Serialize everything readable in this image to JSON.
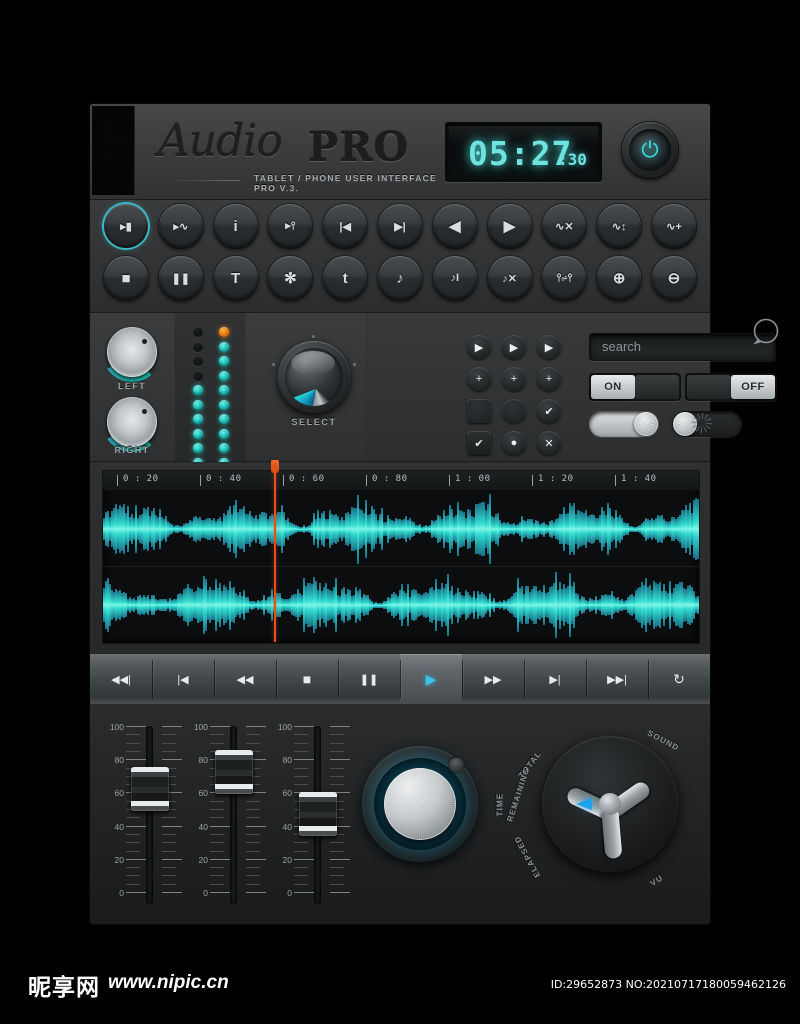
{
  "header": {
    "logo_script": "Audio",
    "logo_bold": "PRO",
    "subtitle": "TABLET / PHONE USER INTERFACE PRO V.3.",
    "clock_main": "05:27",
    "clock_seconds": ":30",
    "power_icon": "power-icon",
    "power_glyph": "⏻",
    "accent_color": "#6fe3e0"
  },
  "button_rows": {
    "row1": [
      {
        "name": "record-marker",
        "glyph": "▸▮",
        "active": true
      },
      {
        "name": "marker-wave",
        "glyph": "▸∿",
        "active": false
      },
      {
        "name": "info",
        "glyph": "i",
        "active": false
      },
      {
        "name": "marker-split",
        "glyph": "▸⫯",
        "active": false
      },
      {
        "name": "skip-start",
        "glyph": "|◀",
        "active": false
      },
      {
        "name": "skip-end",
        "glyph": "▶|",
        "active": false
      },
      {
        "name": "rewind",
        "glyph": "◀",
        "active": false
      },
      {
        "name": "play",
        "glyph": "▶",
        "active": false
      },
      {
        "name": "wave-delete",
        "glyph": "∿✕",
        "active": false
      },
      {
        "name": "wave-adjust",
        "glyph": "∿↕",
        "active": false
      },
      {
        "name": "wave-add",
        "glyph": "∿+",
        "active": false
      }
    ],
    "row2": [
      {
        "name": "stop",
        "glyph": "■"
      },
      {
        "name": "pause",
        "glyph": "❚❚"
      },
      {
        "name": "text",
        "glyph": "T"
      },
      {
        "name": "settings-gear",
        "glyph": "✻"
      },
      {
        "name": "transpose",
        "glyph": "t"
      },
      {
        "name": "note",
        "glyph": "♪"
      },
      {
        "name": "note-edit",
        "glyph": "♪I"
      },
      {
        "name": "note-delete",
        "glyph": "♪✕"
      },
      {
        "name": "waveform-trim",
        "glyph": "⫯⩫⫯"
      },
      {
        "name": "zoom-in",
        "glyph": "⊕"
      },
      {
        "name": "zoom-out",
        "glyph": "⊖"
      }
    ]
  },
  "controls": {
    "knob_left_label": "LEFT",
    "knob_right_label": "RIGHT",
    "select_label": "SELECT",
    "led_left": [
      "off",
      "off",
      "off",
      "off",
      "on",
      "on",
      "on",
      "on",
      "on",
      "on"
    ],
    "led_right": [
      "warn",
      "on",
      "on",
      "on",
      "on",
      "on",
      "on",
      "on",
      "on",
      "on"
    ],
    "mini_buttons": [
      [
        {
          "name": "play-small-1",
          "glyph": "▶"
        },
        {
          "name": "play-small-2",
          "glyph": "▶"
        },
        {
          "name": "play-small-3",
          "glyph": "▶"
        }
      ],
      [
        {
          "name": "add-1",
          "glyph": "+"
        },
        {
          "name": "add-2",
          "glyph": "+"
        },
        {
          "name": "add-3",
          "glyph": "+"
        }
      ],
      [
        {
          "name": "checkbox-empty",
          "glyph": ""
        },
        {
          "name": "radio-empty",
          "glyph": ""
        },
        {
          "name": "check-circle",
          "glyph": "✔"
        }
      ],
      [
        {
          "name": "checkbox-checked",
          "glyph": "✔"
        },
        {
          "name": "radio-selected",
          "glyph": "●"
        },
        {
          "name": "close-circle",
          "glyph": "✕"
        }
      ]
    ],
    "search_placeholder": "search",
    "search_value": "",
    "toggle_on_label": "ON",
    "toggle_off_label": "OFF",
    "switch_left_state": "on",
    "switch_right_state": "off",
    "spinner_name": "loading-spinner"
  },
  "waveform": {
    "ruler_ticks": [
      "0 : 20",
      "0 : 40",
      "0 : 60",
      "0 : 80",
      "1 : 00",
      "1 : 20",
      "1 : 40"
    ],
    "playhead_position_pct": 28.8,
    "wave_color": "#2fd8cd",
    "wave_highlight": "#7cf5e6",
    "playhead_color": "#e4511e",
    "channels": 2
  },
  "transport": [
    {
      "name": "rewind-to-start",
      "glyph": "◀◀|"
    },
    {
      "name": "previous-track",
      "glyph": "|◀"
    },
    {
      "name": "rewind",
      "glyph": "◀◀"
    },
    {
      "name": "stop",
      "glyph": "■"
    },
    {
      "name": "pause",
      "glyph": "❚❚"
    },
    {
      "name": "play",
      "glyph": "▶",
      "selected": true
    },
    {
      "name": "fast-forward",
      "glyph": "▶▶"
    },
    {
      "name": "next-track",
      "glyph": "▶|"
    },
    {
      "name": "forward-to-end",
      "glyph": "▶▶|"
    },
    {
      "name": "repeat",
      "glyph": "↻"
    }
  ],
  "faders": [
    {
      "name": "fader-1",
      "value": 62,
      "scale": [
        0,
        20,
        40,
        60,
        80,
        100
      ]
    },
    {
      "name": "fader-2",
      "value": 72,
      "scale": [
        0,
        20,
        40,
        60,
        80,
        100
      ]
    },
    {
      "name": "fader-3",
      "value": 47,
      "scale": [
        0,
        20,
        40,
        60,
        80,
        100
      ]
    }
  ],
  "big_knob": {
    "name": "volume-knob",
    "glow_color": "#0d4f63"
  },
  "selector_knob": {
    "name": "mode-selector-knob",
    "labels": [
      "TIME",
      "TOTAL",
      "REMAINING",
      "ELAPSED",
      "SOUND",
      "VU"
    ],
    "pointer_color": "#1ca2e8"
  },
  "watermark": {
    "logo": "昵享网",
    "url": "www.nipic.cn",
    "id": "ID:29652873 NO:20210717180059462126"
  }
}
